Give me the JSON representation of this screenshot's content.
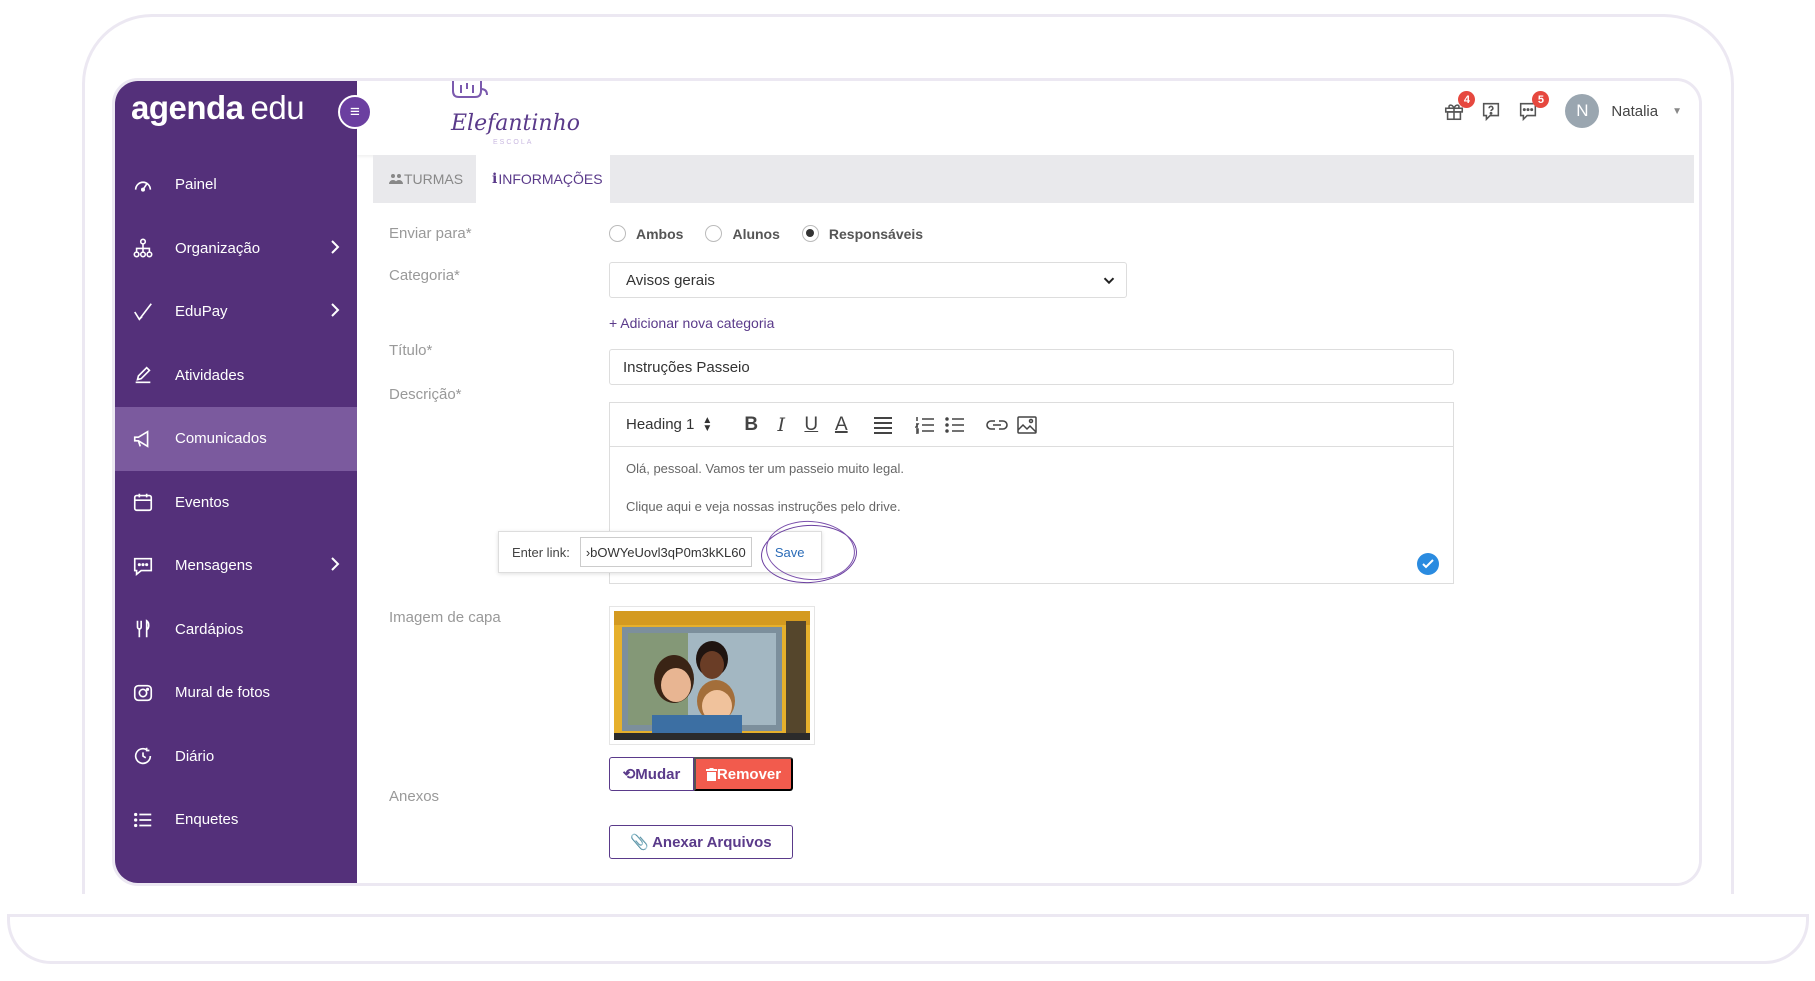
{
  "brand": {
    "logo_part1": "agenda",
    "logo_part2": "edu",
    "school_name": "Elefantinho",
    "school_sub": "ESCOLA",
    "colors": {
      "sidebar": "#54307a",
      "sidebar_active": "#7b5a9e",
      "accent": "#5a3a8a",
      "danger": "#f25b4d",
      "badge": "#e6483f",
      "info": "#2a8be0"
    }
  },
  "sidebar": {
    "items": [
      {
        "label": "Painel",
        "icon": "speedometer-icon",
        "has_children": false,
        "active": false
      },
      {
        "label": "Organização",
        "icon": "org-chart-icon",
        "has_children": true,
        "active": false
      },
      {
        "label": "EduPay",
        "icon": "check-pen-icon",
        "has_children": true,
        "active": false
      },
      {
        "label": "Atividades",
        "icon": "pencil-icon",
        "has_children": false,
        "active": false
      },
      {
        "label": "Comunicados",
        "icon": "megaphone-icon",
        "has_children": false,
        "active": true
      },
      {
        "label": "Eventos",
        "icon": "calendar-icon",
        "has_children": false,
        "active": false
      },
      {
        "label": "Mensagens",
        "icon": "chat-icon",
        "has_children": true,
        "active": false
      },
      {
        "label": "Cardápios",
        "icon": "utensils-icon",
        "has_children": false,
        "active": false
      },
      {
        "label": "Mural de fotos",
        "icon": "camera-icon",
        "has_children": false,
        "active": false
      },
      {
        "label": "Diário",
        "icon": "clock-icon",
        "has_children": false,
        "active": false
      },
      {
        "label": "Enquetes",
        "icon": "list-icon",
        "has_children": false,
        "active": false
      }
    ]
  },
  "header": {
    "gift_badge": "4",
    "messages_badge": "5",
    "user_initial": "N",
    "user_name": "Natalia"
  },
  "tabs": [
    {
      "label": "TURMAS",
      "active": false
    },
    {
      "label": "INFORMAÇÕES",
      "active": true
    }
  ],
  "form": {
    "send_to_label": "Enviar para*",
    "send_to_options": [
      "Ambos",
      "Alunos",
      "Responsáveis"
    ],
    "send_to_selected": "Responsáveis",
    "category_label": "Categoria*",
    "category_value": "Avisos gerais",
    "add_category": "+ Adicionar nova categoria",
    "title_label": "Título*",
    "title_value": "Instruções Passeio",
    "description_label": "Descrição*",
    "heading_value": "Heading 1",
    "description_lines": [
      "Olá, pessoal. Vamos ter um passeio muito legal.",
      "Clique aqui e veja nossas instruções pelo drive."
    ],
    "link_label": "Enter link:",
    "link_value": "›bOWYeUovl3qP0m3kKL60",
    "link_save": "Save",
    "cover_label": "Imagem de capa",
    "change_button": "Mudar",
    "remove_button": "Remover",
    "attachments_label": "Anexos",
    "attach_button": "Anexar Arquivos"
  }
}
